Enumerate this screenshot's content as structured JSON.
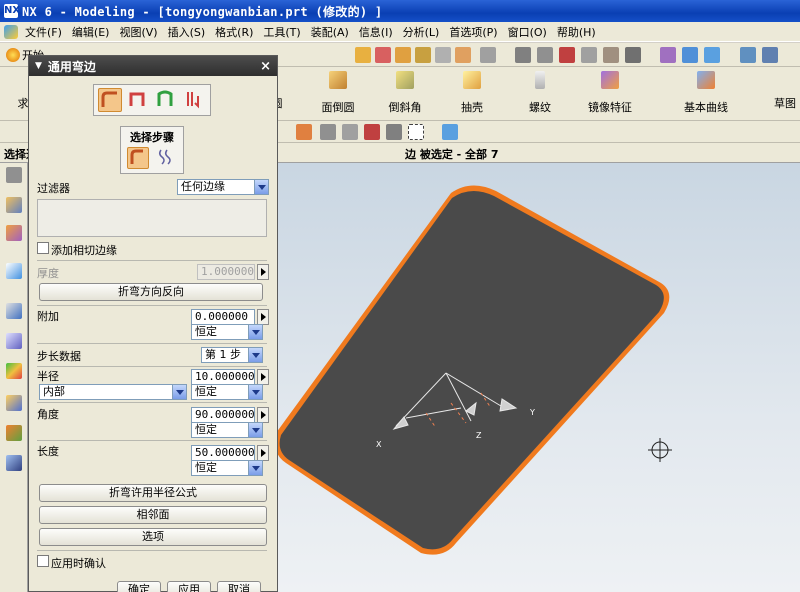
{
  "window": {
    "title": "NX 6 - Modeling - [tongyongwanbian.prt  (修改的)  ]",
    "logo": "NX"
  },
  "menu": [
    "文件(F)",
    "编辑(E)",
    "视图(V)",
    "插入(S)",
    "格式(R)",
    "工具(T)",
    "装配(A)",
    "信息(I)",
    "分析(L)",
    "首选项(P)",
    "窗口(O)",
    "帮助(H)"
  ],
  "toolbar": {
    "start_label": "开始"
  },
  "features": {
    "f0": "求",
    "f1": "圆",
    "f2": "面倒圆",
    "f3": "倒斜角",
    "f4": "抽壳",
    "f5": "螺纹",
    "f6": "镜像特征",
    "f7": "基本曲线",
    "f8": "草图"
  },
  "status": {
    "left": "选择过",
    "center": "边 被选定 - 全部 7"
  },
  "dialog": {
    "title": "通用弯边",
    "step_label": "选择步骤",
    "filter_label": "过滤器",
    "filter_value": "任何边缘",
    "add_tangent_label": "添加相切边缘",
    "thickness_label": "厚度",
    "thickness_value": "1.000000",
    "reverse_btn": "折弯方向反向",
    "offset_label": "附加",
    "offset_value": "0.000000",
    "offset_mode": "恒定",
    "step_data_label": "步长数据",
    "step_data_value": "第 1 步",
    "radius_label": "半径",
    "radius_value": "10.000000",
    "radius_side": "内部",
    "radius_mode": "恒定",
    "angle_label": "角度",
    "angle_value": "90.000000",
    "angle_mode": "恒定",
    "length_label": "长度",
    "length_value": "50.000000",
    "length_mode": "恒定",
    "formula_btn": "折弯许用半径公式",
    "adjacent_btn": "相邻面",
    "options_btn": "选项",
    "confirm_on_apply_label": "应用时确认",
    "ok_btn": "确定",
    "apply_btn": "应用",
    "cancel_btn": "取消"
  },
  "viewport": {
    "axis_x": "X",
    "axis_y": "Y",
    "axis_z": "Z"
  },
  "colors": {
    "part_face": "#4a4a4a",
    "part_edge": "#f07a1e",
    "title_blue": "#0a3fb3"
  }
}
